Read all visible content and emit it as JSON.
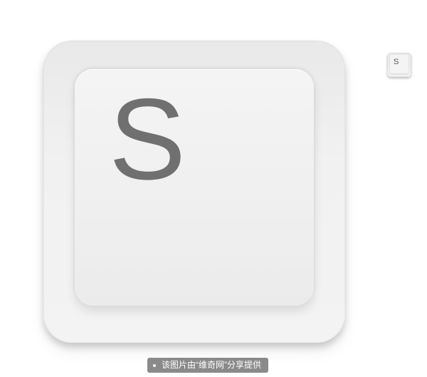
{
  "main_key": {
    "letter": "S"
  },
  "thumbnail_key": {
    "letter": "S"
  },
  "caption": {
    "text": "该图片由“维奇网”分享提供"
  },
  "colors": {
    "background": "#ffffff",
    "key_letter": "#707070",
    "caption_bg": "#8a8a8a",
    "caption_text": "#ffffff"
  }
}
